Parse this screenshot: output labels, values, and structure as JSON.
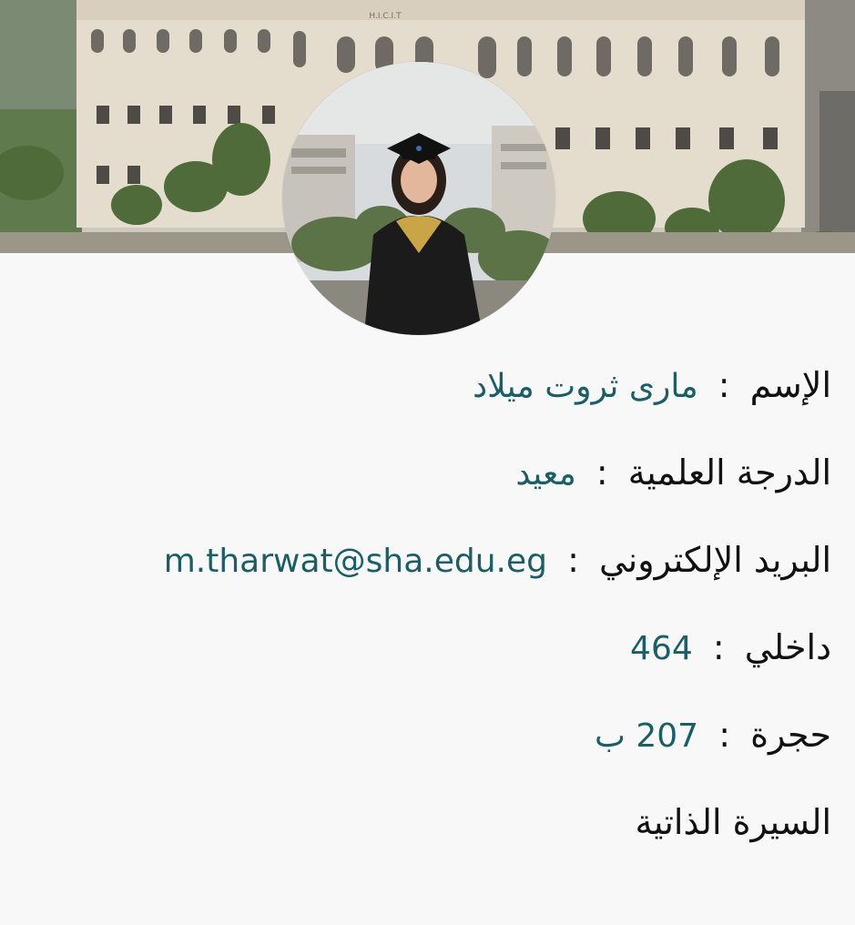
{
  "profile": {
    "name_label": "الإسم",
    "name_value": "مارى ثروت ميلاد",
    "degree_label": "الدرجة العلمية",
    "degree_value": "معيد",
    "email_label": "البريد الإلكتروني",
    "email_value": "m.tharwat@sha.edu.eg",
    "ext_label": "داخلي",
    "ext_value": "464",
    "room_label": "حجرة",
    "room_value": "207 ب",
    "separator": ":",
    "cv_link": "السيرة الذاتية"
  },
  "cover": {
    "building_sign": "H.I.C.I.T"
  },
  "colors": {
    "value_color": "#1b5f66",
    "label_color": "#111111",
    "background": "#f8f8f8"
  }
}
